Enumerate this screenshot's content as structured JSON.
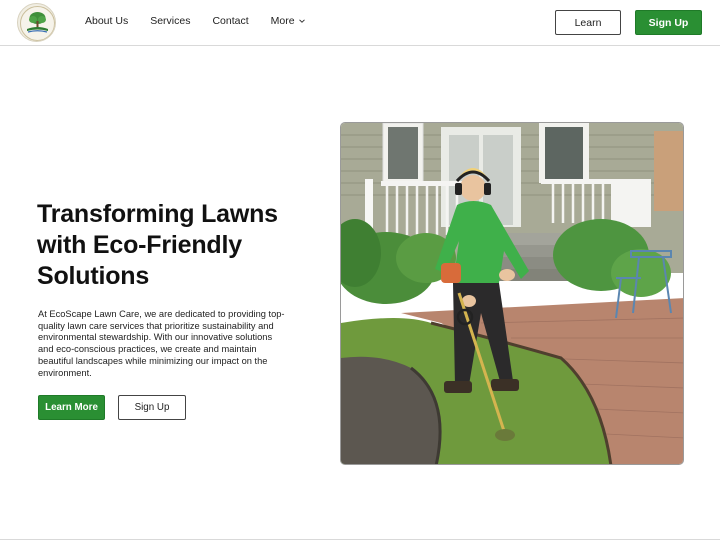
{
  "brand": {
    "logo_icon": "tree-lawn-logo-icon",
    "accent_color": "#2a8f33"
  },
  "nav": {
    "links": [
      {
        "label": "About Us"
      },
      {
        "label": "Services"
      },
      {
        "label": "Contact"
      },
      {
        "label": "More"
      }
    ],
    "more_icon": "chevron-down-icon",
    "login_label": "Learn",
    "signup_label": "Sign Up"
  },
  "hero": {
    "headline": "Transforming Lawns with Eco-Friendly Solutions",
    "description": "At EcoScape Lawn Care, we are dedicated to providing top-quality lawn care services that prioritize sustainability and environmental stewardship. With our innovative solutions and eco-conscious practices, we create and maintain beautiful landscapes while minimizing our impact on the environment.",
    "primary_button": "Learn More",
    "secondary_button": "Sign Up"
  }
}
